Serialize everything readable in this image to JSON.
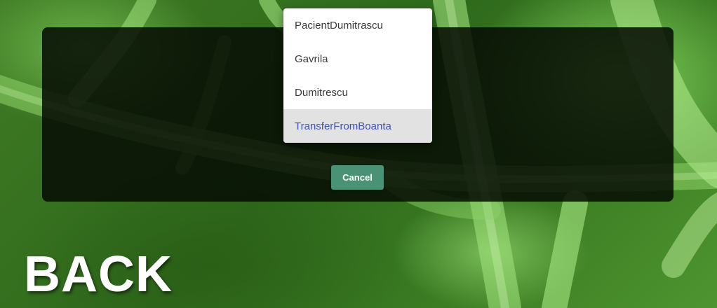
{
  "colors": {
    "background_green": "#3f7a24",
    "overlay": "#060c04",
    "cancel_button": "#4a9275",
    "selected_option_bg": "#e2e2e2",
    "selected_option_text": "#3f51b5"
  },
  "dropdown": {
    "options": [
      {
        "label": "PacientDumitrascu",
        "selected": false
      },
      {
        "label": "Gavrila",
        "selected": false
      },
      {
        "label": "Dumitrescu",
        "selected": false
      },
      {
        "label": "TransferFromBoanta",
        "selected": true
      }
    ]
  },
  "dialog": {
    "cancel_label": "Cancel"
  },
  "back": {
    "label": "BACK"
  }
}
